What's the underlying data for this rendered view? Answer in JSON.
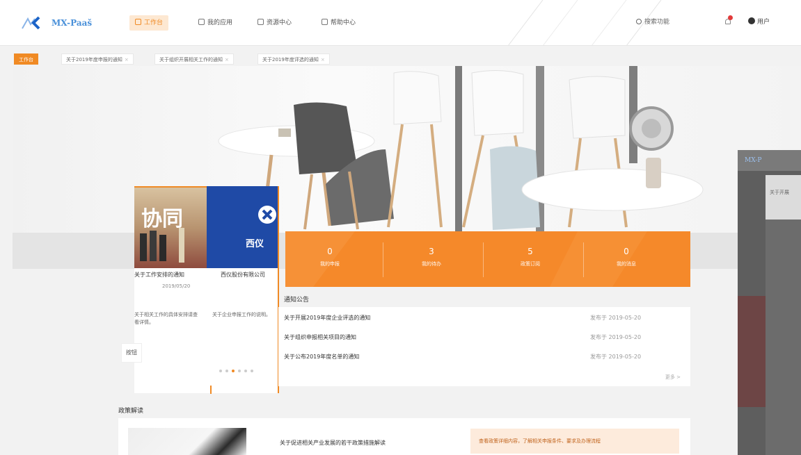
{
  "header": {
    "logo_text": "MX-Paaš",
    "nav": [
      {
        "label": "工作台"
      },
      {
        "label": "我的应用"
      },
      {
        "label": "资源中心"
      },
      {
        "label": "帮助中心"
      }
    ],
    "search_label": "搜索功能",
    "user_label": "用户"
  },
  "tabs": [
    {
      "label": "工作台"
    },
    {
      "label": "关于2019年度申报的通知"
    },
    {
      "label": "关于组织开展相关工作的通知"
    },
    {
      "label": "关于2019年度评选的通知"
    }
  ],
  "stats": [
    {
      "value": "0",
      "label": "我的申报"
    },
    {
      "value": "3",
      "label": "我的待办"
    },
    {
      "value": "5",
      "label": "政策订阅"
    },
    {
      "value": "0",
      "label": "我的消息"
    }
  ],
  "carousel": {
    "slide1_text": "协同",
    "slide2_text": "西仪",
    "captions": [
      {
        "title": "关于工作安排的通知",
        "date": "2019/05/20",
        "desc": "关于相关工作的具体安排请查看详情。"
      },
      {
        "title": "西仪股份有限公司",
        "desc": "关于企业申报工作的说明。"
      }
    ],
    "dots": [
      false,
      false,
      true,
      false,
      false,
      false
    ],
    "nav_btn": "按钮"
  },
  "announcements": {
    "title": "通知公告",
    "items": [
      {
        "title": "关于开展2019年度企业评选的通知",
        "date": "发布于 2019-05-20"
      },
      {
        "title": "关于组织申报相关项目的通知",
        "date": "发布于 2019-05-20"
      },
      {
        "title": "关于公布2019年度名单的通知",
        "date": "发布于 2019-05-20"
      }
    ],
    "more": "更多 >"
  },
  "policy": {
    "title": "政策解读",
    "item_title": "关于促进相关产业发展的若干政策措施解读",
    "tag": "查看政策详细内容，了解相关申报条件、要求及办理流程"
  },
  "overlay": {
    "logo_text": "MX-P",
    "head_text": "关于开展"
  }
}
